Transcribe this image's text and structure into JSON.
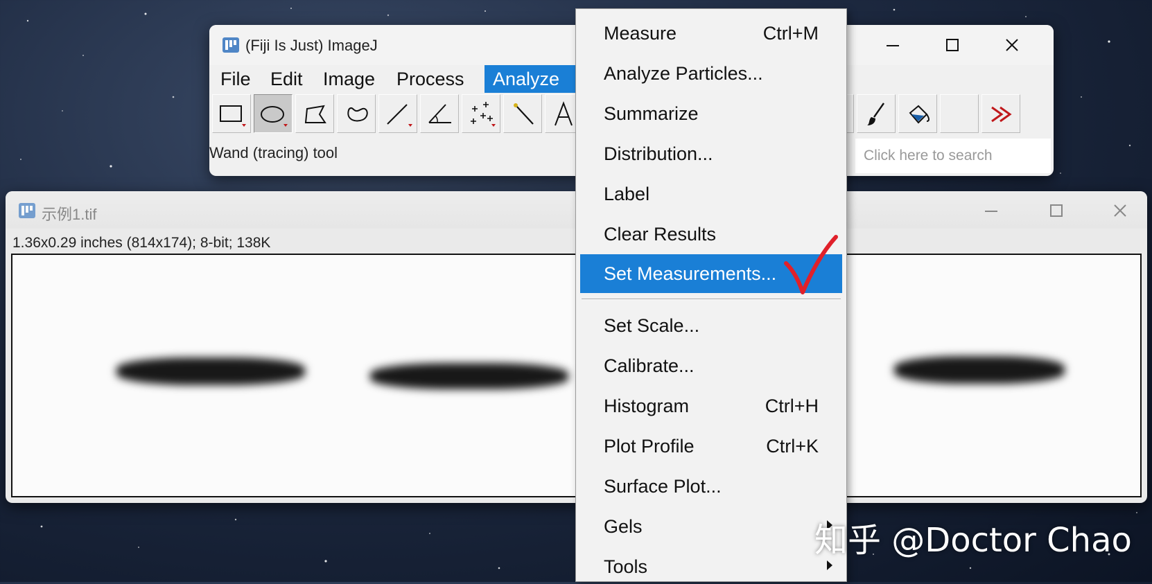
{
  "main_window": {
    "title": "(Fiji Is Just) ImageJ",
    "menus": [
      "File",
      "Edit",
      "Image",
      "Process",
      "Analyze"
    ],
    "active_menu": "Analyze",
    "tools": [
      {
        "icon": "rectangle-tool-icon",
        "pressed": false
      },
      {
        "icon": "oval-tool-icon",
        "pressed": true
      },
      {
        "icon": "polygon-tool-icon",
        "pressed": false
      },
      {
        "icon": "freehand-tool-icon",
        "pressed": false
      },
      {
        "icon": "line-tool-icon",
        "pressed": false
      },
      {
        "icon": "angle-tool-icon",
        "pressed": false
      },
      {
        "icon": "multipoint-tool-icon",
        "pressed": false
      },
      {
        "icon": "wand-tool-icon",
        "pressed": false
      },
      {
        "icon": "text-tool-icon",
        "pressed": false
      }
    ],
    "right_tools": [
      {
        "icon": "pencil-tool-icon"
      },
      {
        "icon": "brush-tool-icon"
      },
      {
        "icon": "flood-fill-tool-icon"
      },
      {
        "icon": "empty-tool-slot-icon"
      },
      {
        "icon": "more-tools-icon"
      }
    ],
    "status": "Wand (tracing) tool",
    "search_placeholder": "Click here to search"
  },
  "image_window": {
    "title": "示例1.tif",
    "info": "1.36x0.29 inches (814x174); 8-bit; 138K"
  },
  "analyze_menu": {
    "items": [
      {
        "label": "Measure",
        "shortcut": "Ctrl+M"
      },
      {
        "label": "Analyze Particles...",
        "shortcut": ""
      },
      {
        "label": "Summarize",
        "shortcut": ""
      },
      {
        "label": "Distribution...",
        "shortcut": ""
      },
      {
        "label": "Label",
        "shortcut": ""
      },
      {
        "label": "Clear Results",
        "shortcut": ""
      },
      {
        "label": "Set Measurements...",
        "shortcut": "",
        "highlighted": true
      },
      {
        "label": "Set Scale...",
        "shortcut": ""
      },
      {
        "label": "Calibrate...",
        "shortcut": ""
      },
      {
        "label": "Histogram",
        "shortcut": "Ctrl+H"
      },
      {
        "label": "Plot Profile",
        "shortcut": "Ctrl+K"
      },
      {
        "label": "Surface Plot...",
        "shortcut": ""
      },
      {
        "label": "Gels",
        "shortcut": "",
        "submenu": true
      },
      {
        "label": "Tools",
        "shortcut": "",
        "submenu": true
      }
    ]
  },
  "watermark": "知乎 @Doctor Chao",
  "colors": {
    "highlight": "#1a7fd6",
    "checkmark": "#e0202a",
    "tool_indicator": "#c0181b"
  }
}
